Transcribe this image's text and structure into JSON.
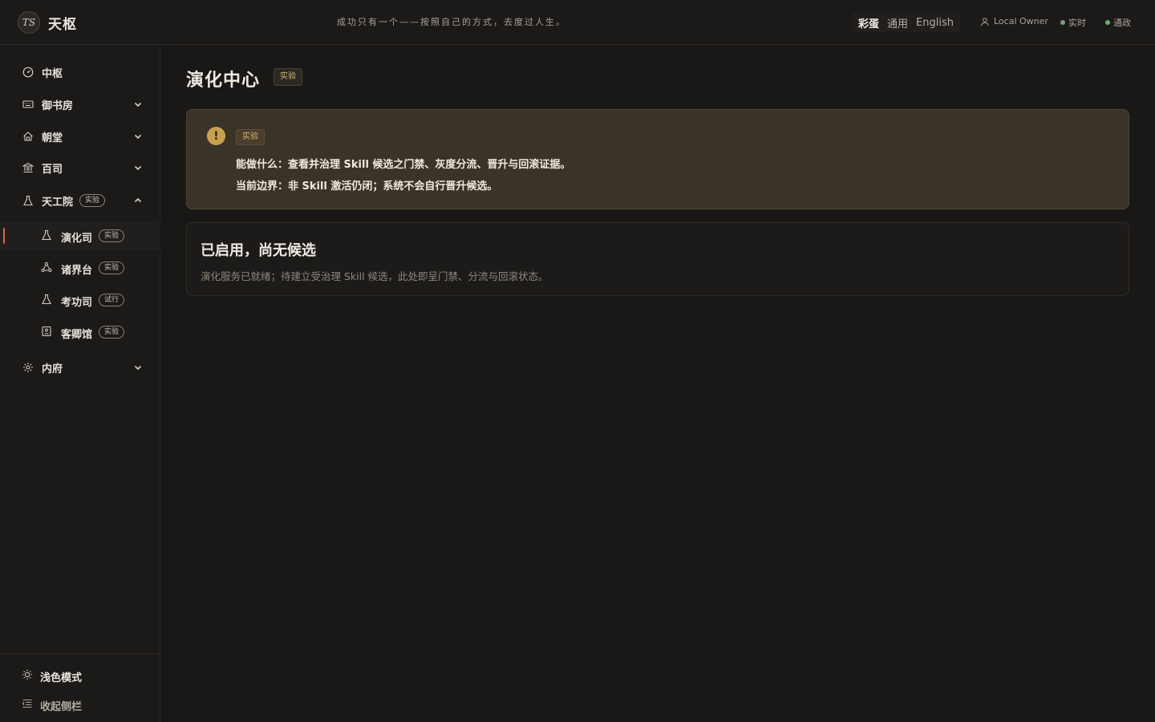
{
  "header": {
    "logo_text": "TS",
    "brand": "天枢",
    "motto": "成功只有一个——按照自己的方式，去度过人生。",
    "lang_options": [
      "彩蛋",
      "通用",
      "English"
    ],
    "active_lang": "彩蛋",
    "user": "Local Owner",
    "status_realtime": "实时",
    "status_govern": "通政"
  },
  "sidebar": {
    "items": [
      {
        "label": "中枢",
        "icon": "dashboard-icon"
      },
      {
        "label": "御书房",
        "icon": "keyboard-icon",
        "chevron": "down"
      },
      {
        "label": "朝堂",
        "icon": "home-icon",
        "chevron": "down"
      },
      {
        "label": "百司",
        "icon": "bank-icon",
        "chevron": "down"
      },
      {
        "label": "天工院",
        "icon": "flask-icon",
        "badge": "实验",
        "chevron": "up"
      },
      {
        "label": "内府",
        "icon": "gear-icon",
        "chevron": "down"
      }
    ],
    "sub_items": [
      {
        "label": "演化司",
        "badge": "实验",
        "icon": "flask-icon"
      },
      {
        "label": "诸界台",
        "badge": "实验",
        "icon": "network-icon"
      },
      {
        "label": "考功司",
        "badge": "试行",
        "icon": "flask-icon"
      },
      {
        "label": "客卿馆",
        "badge": "实验",
        "icon": "id-card-icon"
      }
    ],
    "bottom": {
      "theme_toggle": "浅色模式",
      "collapse": "收起侧栏"
    }
  },
  "main": {
    "title": "演化中心",
    "title_badge": "实验",
    "notice": {
      "badge": "实验",
      "line1": "能做什么：查看并治理 Skill 候选之门禁、灰度分流、晋升与回滚证据。",
      "line2": "当前边界：非 Skill 激活仍闭；系统不会自行晋升候选。"
    },
    "empty": {
      "title": "已启用，尚无候选",
      "desc": "演化服务已就绪；待建立受治理 Skill 候选，此处即呈门禁、分流与回滚状态。"
    }
  },
  "colors": {
    "accent": "#d86a4a",
    "warning": "#c9a14e",
    "status_green": "#5bb85c"
  }
}
